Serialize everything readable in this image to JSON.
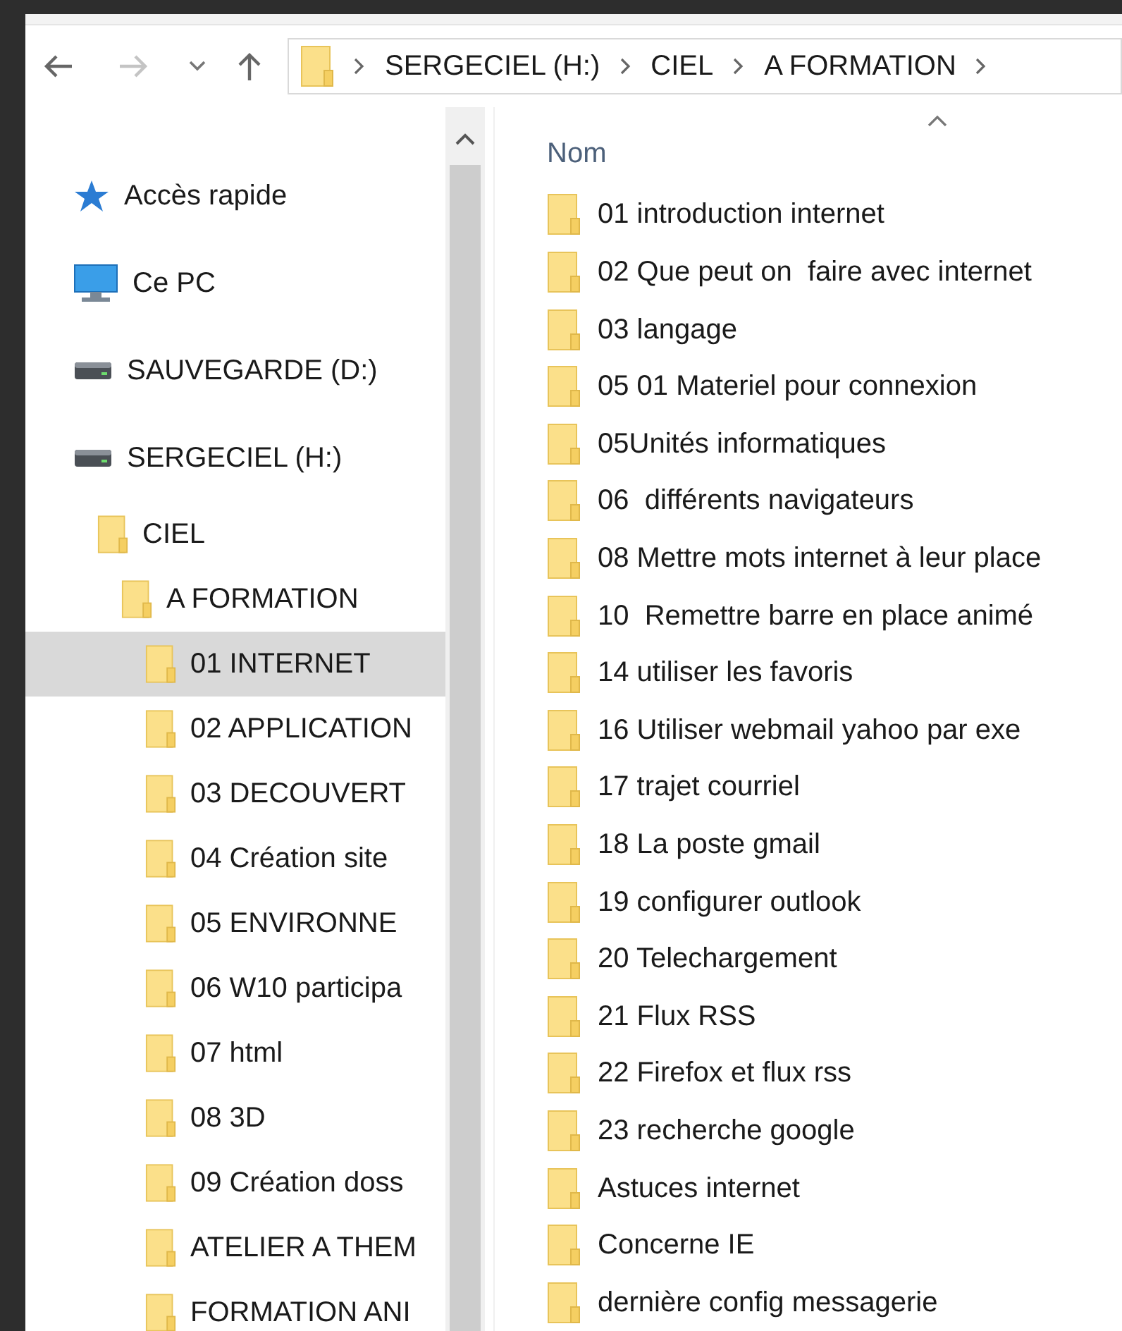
{
  "toolbar": {
    "breadcrumb": [
      "SERGECIEL (H:)",
      "CIEL",
      "A FORMATION"
    ]
  },
  "navigation": [
    {
      "label": "Accès rapide",
      "kind": "star",
      "selected": false
    },
    {
      "label": "Ce PC",
      "kind": "pc",
      "selected": false
    },
    {
      "label": "SAUVEGARDE (D:)",
      "kind": "drive",
      "selected": false
    },
    {
      "label": "SERGECIEL (H:)",
      "kind": "drive",
      "selected": false,
      "children": [
        {
          "label": "CIEL",
          "kind": "folder",
          "selected": false,
          "children": [
            {
              "label": "A FORMATION",
              "kind": "folder",
              "selected": false,
              "children": [
                {
                  "label": "01 INTERNET",
                  "kind": "folder",
                  "selected": true
                },
                {
                  "label": "02 APPLICATION",
                  "kind": "folder",
                  "selected": false
                },
                {
                  "label": "03 DECOUVERT",
                  "kind": "folder",
                  "selected": false
                },
                {
                  "label": "04 Création site",
                  "kind": "folder",
                  "selected": false
                },
                {
                  "label": "05 ENVIRONNE",
                  "kind": "folder",
                  "selected": false
                },
                {
                  "label": "06 W10 participa",
                  "kind": "folder",
                  "selected": false
                },
                {
                  "label": "07 html",
                  "kind": "folder",
                  "selected": false
                },
                {
                  "label": "08 3D",
                  "kind": "folder",
                  "selected": false
                },
                {
                  "label": "09 Création doss",
                  "kind": "folder",
                  "selected": false
                },
                {
                  "label": "ATELIER A THEM",
                  "kind": "folder",
                  "selected": false
                },
                {
                  "label": "FORMATION ANI",
                  "kind": "folder",
                  "selected": false
                }
              ]
            }
          ]
        }
      ]
    }
  ],
  "file_list": {
    "column": "Nom",
    "items": [
      "01 introduction internet",
      "02 Que peut on  faire avec internet",
      "03 langage",
      "05 01 Materiel pour connexion",
      "05Unités informatiques",
      "06  différents navigateurs",
      "08 Mettre mots internet à leur place",
      "10  Remettre barre en place animé",
      "14 utiliser les favoris",
      "16 Utiliser webmail yahoo par exe",
      "17 trajet courriel",
      "18 La poste gmail",
      "19 configurer outlook",
      "20 Telechargement",
      "21 Flux RSS",
      "22 Firefox et flux rss",
      "23 recherche google",
      "Astuces internet",
      "Concerne IE",
      "dernière config messagerie"
    ]
  }
}
